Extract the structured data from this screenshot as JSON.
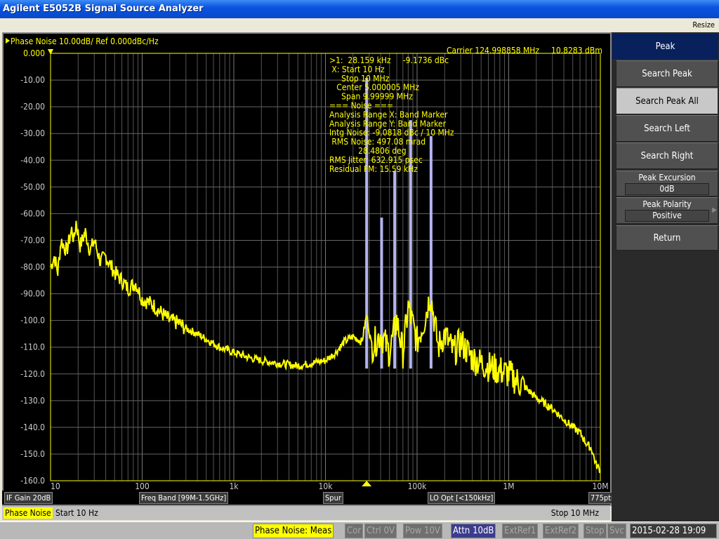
{
  "window": {
    "title": "Agilent E5052B Signal Source Analyzer",
    "resize_label": "Resize"
  },
  "trace_header": {
    "label": "Phase Noise 10.00dB/ Ref 0.000dBc/Hz",
    "carrier": "Carrier 124.998858 MHz",
    "carrier_power": "10.8283 dBm"
  },
  "marker_readout": [
    ">1:  28.159 kHz     -9.1736 dBc",
    " X: Start 10 Hz",
    "     Stop 10 MHz",
    "   Center 5.000005 MHz",
    "     Span 9.99999 MHz",
    "=== Noise ===",
    "Analysis Range X: Band Marker",
    "Analysis Range Y: Band Marker",
    "Intg Noise: -9.0818 dBc / 10 MHz",
    " RMS Noise: 497.08 mrad",
    "            28.4806 deg",
    "RMS Jitter: 632.915 psec",
    "Residual FM: 15.59 kHz"
  ],
  "chart_data": {
    "type": "line",
    "xscale": "log",
    "xlim": [
      10,
      10000000
    ],
    "ylim": [
      -160,
      0
    ],
    "grid": true,
    "x_tick_labels": [
      "10",
      "100",
      "1k",
      "10k",
      "100k",
      "1M",
      "10M"
    ],
    "y_tick_labels": [
      "0.000",
      "-10.00",
      "-20.00",
      "-30.00",
      "-40.00",
      "-50.00",
      "-60.00",
      "-70.00",
      "-80.00",
      "-90.00",
      "-100.0",
      "-110.0",
      "-120.0",
      "-130.0",
      "-140.0",
      "-150.0",
      "-160.0"
    ],
    "trace_color": "#ffff00",
    "spur_color": "#b4b4f0",
    "trace": [
      [
        10,
        -80
      ],
      [
        11,
        -76
      ],
      [
        12,
        -82
      ],
      [
        13,
        -70
      ],
      [
        15,
        -74
      ],
      [
        17,
        -66
      ],
      [
        18,
        -70
      ],
      [
        19,
        -63
      ],
      [
        21,
        -72
      ],
      [
        24,
        -67
      ],
      [
        27,
        -74
      ],
      [
        30,
        -70
      ],
      [
        35,
        -78
      ],
      [
        40,
        -76
      ],
      [
        50,
        -82
      ],
      [
        60,
        -85
      ],
      [
        70,
        -88
      ],
      [
        85,
        -86
      ],
      [
        100,
        -92
      ],
      [
        130,
        -94
      ],
      [
        160,
        -97
      ],
      [
        200,
        -100
      ],
      [
        250,
        -101
      ],
      [
        300,
        -103
      ],
      [
        400,
        -105
      ],
      [
        500,
        -107
      ],
      [
        700,
        -110
      ],
      [
        1000,
        -112
      ],
      [
        1500,
        -114
      ],
      [
        2000,
        -115
      ],
      [
        3000,
        -116
      ],
      [
        5000,
        -117
      ],
      [
        7000,
        -116
      ],
      [
        10000,
        -115
      ],
      [
        13000,
        -112
      ],
      [
        16000,
        -108
      ],
      [
        20000,
        -106
      ],
      [
        25000,
        -108
      ],
      [
        28159,
        -98
      ],
      [
        32000,
        -110
      ],
      [
        40000,
        -105
      ],
      [
        50000,
        -112
      ],
      [
        60000,
        -100
      ],
      [
        70000,
        -112
      ],
      [
        80000,
        -95
      ],
      [
        100000,
        -108
      ],
      [
        120000,
        -100
      ],
      [
        140000,
        -90
      ],
      [
        170000,
        -110
      ],
      [
        200000,
        -105
      ],
      [
        250000,
        -112
      ],
      [
        300000,
        -108
      ],
      [
        400000,
        -114
      ],
      [
        500000,
        -116
      ],
      [
        700000,
        -118
      ],
      [
        1000000,
        -120
      ],
      [
        1500000,
        -125
      ],
      [
        2000000,
        -129
      ],
      [
        3000000,
        -133
      ],
      [
        4000000,
        -137
      ],
      [
        5000000,
        -140
      ],
      [
        6000000,
        -142
      ],
      [
        7000000,
        -146
      ],
      [
        8000000,
        -148
      ],
      [
        9000000,
        -154
      ],
      [
        10000000,
        -156
      ]
    ],
    "spurs": [
      [
        28159,
        -9.17
      ],
      [
        41000,
        -61.5
      ],
      [
        57000,
        -44
      ],
      [
        85000,
        -25
      ],
      [
        142000,
        -31
      ]
    ],
    "marker": {
      "freq": 28159,
      "label": "1"
    }
  },
  "status_row": {
    "if_gain": "IF Gain 20dB",
    "freq_band": "Freq Band [99M-1.5GHz]",
    "spur": "Spur",
    "lo_opt": "LO Opt [<150kHz]",
    "points": "775pts"
  },
  "sweep_row": {
    "meas": "Phase Noise",
    "start": "Start 10 Hz",
    "stop": "Stop 10 MHz"
  },
  "softkeys": {
    "title": "Peak",
    "search_peak": "Search Peak",
    "search_peak_all": "Search Peak All",
    "search_left": "Search Left",
    "search_right": "Search Right",
    "peak_excursion": "Peak Excursion",
    "peak_excursion_value": "0dB",
    "peak_polarity": "Peak Polarity",
    "peak_polarity_value": "Positive",
    "return": "Return"
  },
  "indicators": {
    "meas": "Phase Noise: Meas",
    "cor": "Cor",
    "ctrl": "Ctrl  0V",
    "pow": "Pow  10V",
    "attn": "Attn 10dB",
    "extref1": "ExtRef1",
    "extref2": "ExtRef2",
    "stop": "Stop",
    "svc": "Svc",
    "datetime": "2015-02-28 19:09"
  }
}
